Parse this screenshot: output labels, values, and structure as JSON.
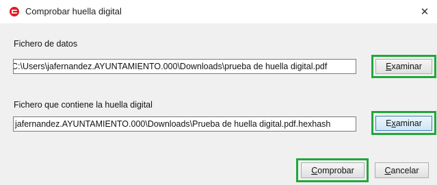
{
  "window": {
    "title": "Comprobar huella digital",
    "icon": "app-logo-icon",
    "close_icon": "close-icon",
    "close_glyph": "✕",
    "brand_color": "#e01b24",
    "highlight_color": "#1fa83a"
  },
  "data_file": {
    "label": "Fichero de datos",
    "value": "C:\\Users\\jafernandez.AYUNTAMIENTO.000\\Downloads\\prueba de huella digital.pdf",
    "browse_button": {
      "mnemonic": "E",
      "rest": "xaminar"
    }
  },
  "hash_file": {
    "label": "Fichero que contiene la huella digital",
    "value": "jafernandez.AYUNTAMIENTO.000\\Downloads\\Prueba de huella digital.pdf.hexhash",
    "browse_button": {
      "pre": "E",
      "mnemonic": "x",
      "rest": "aminar"
    }
  },
  "actions": {
    "verify_button": {
      "mnemonic": "C",
      "rest": "omprobar"
    },
    "cancel_button": {
      "mnemonic": "C",
      "rest": "ancelar"
    }
  }
}
